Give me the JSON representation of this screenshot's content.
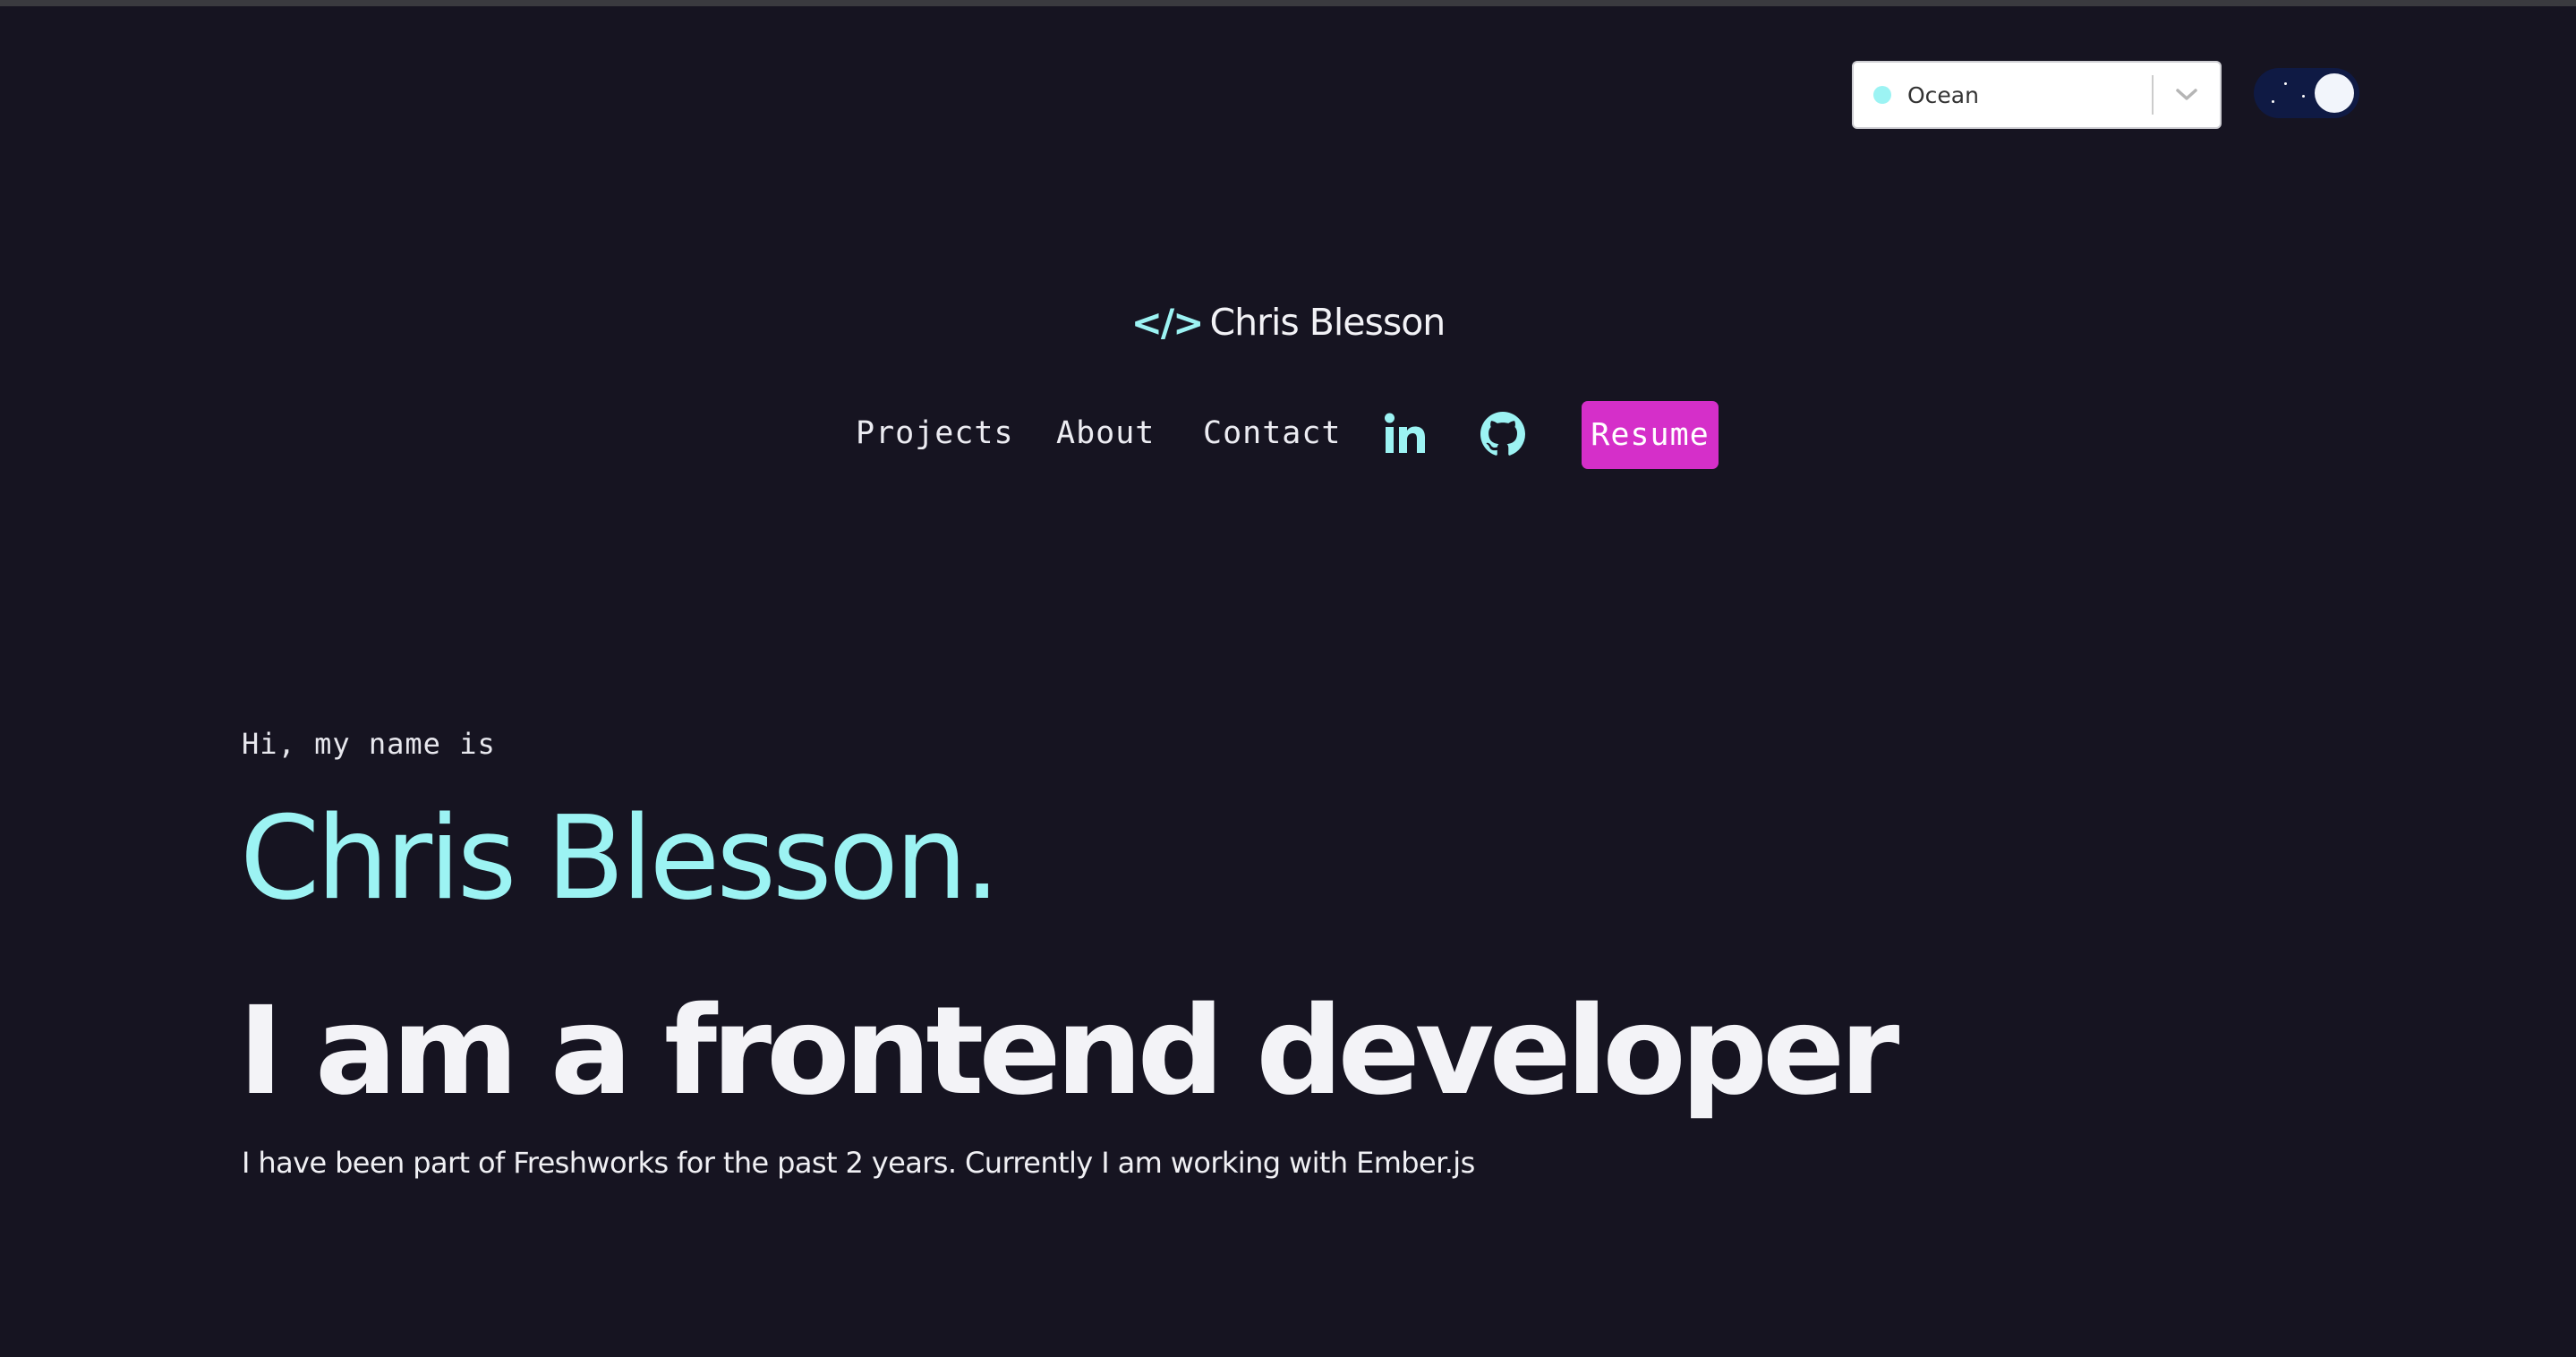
{
  "theme": {
    "selected": "Ocean",
    "accent": "#9cf3f3",
    "background": "#161421",
    "button_color": "#d52fc9"
  },
  "mode_toggle": {
    "state": "dark",
    "icon": "moon-icon"
  },
  "logo": {
    "icon_text": "</>",
    "name": "Chris Blesson"
  },
  "nav": {
    "projects": "Projects",
    "about": "About",
    "contact": "Contact",
    "linkedin_icon": "linkedin-icon",
    "github_icon": "github-icon",
    "resume": "Resume"
  },
  "hero": {
    "greeting": "Hi, my name is",
    "name": "Chris Blesson.",
    "title": "I am a frontend developer",
    "description": "I have been part of Freshworks for the past 2 years. Currently I am working with Ember.js"
  }
}
